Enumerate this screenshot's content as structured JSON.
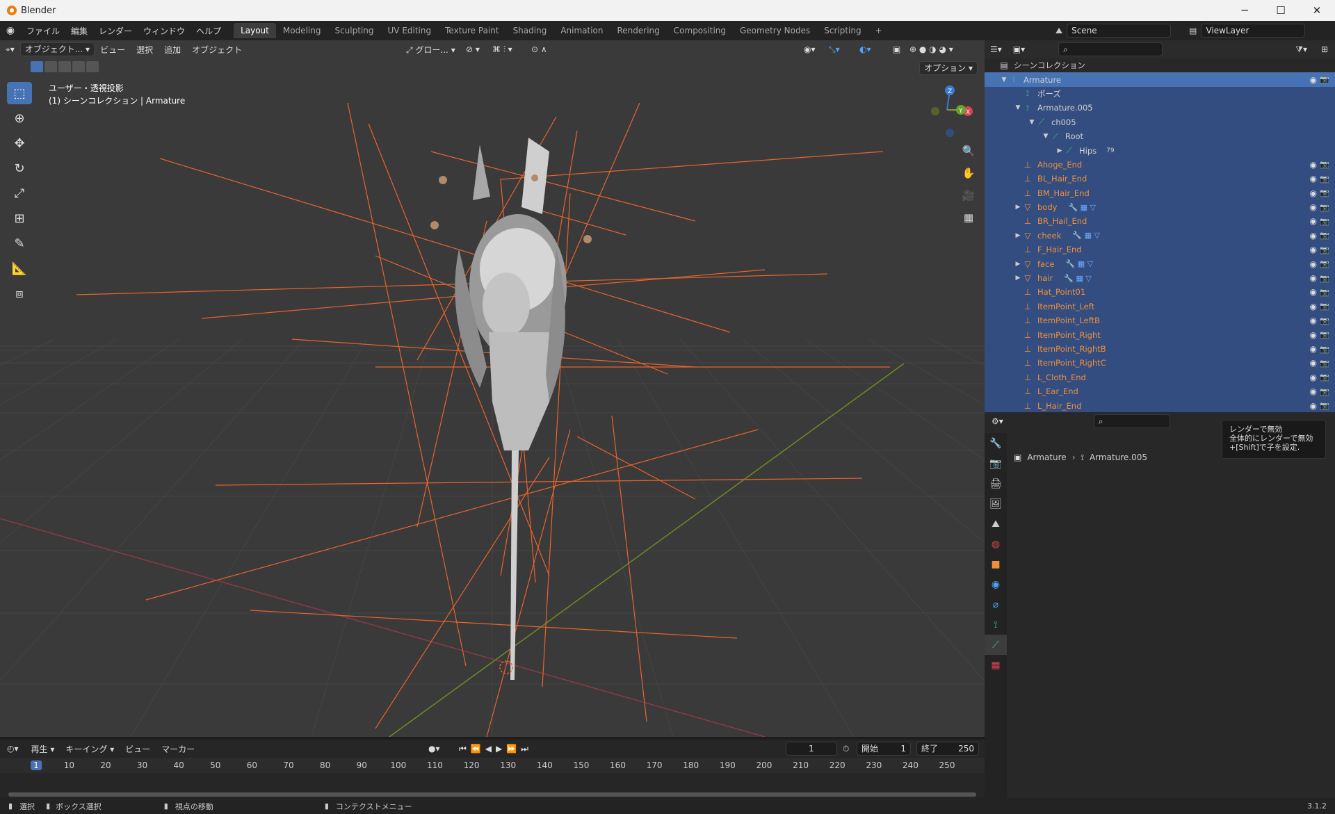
{
  "window": {
    "title": "Blender",
    "min": "─",
    "max": "☐",
    "close": "✕"
  },
  "menu": [
    "ファイル",
    "編集",
    "レンダー",
    "ウィンドウ",
    "ヘルプ"
  ],
  "workspaces": [
    "Layout",
    "Modeling",
    "Sculpting",
    "UV Editing",
    "Texture Paint",
    "Shading",
    "Animation",
    "Rendering",
    "Compositing",
    "Geometry Nodes",
    "Scripting"
  ],
  "scene": {
    "name": "Scene",
    "view_layer": "ViewLayer"
  },
  "viewport": {
    "mode": "オブジェクト...",
    "menus": [
      "ビュー",
      "選択",
      "追加",
      "オブジェクト"
    ],
    "transform": "グロー...",
    "options": "オプション",
    "info_line1": "ユーザー・透視投影",
    "info_line2": "(1) シーンコレクション | Armature"
  },
  "outliner": {
    "root": "シーンコレクション",
    "items": [
      {
        "label": "Armature",
        "depth": 0,
        "arrow": "▼",
        "icon": "armature-icon",
        "style": "selected-strong"
      },
      {
        "label": "ポーズ",
        "depth": 1,
        "arrow": "",
        "icon": "pose-icon",
        "style": "sel"
      },
      {
        "label": "Armature.005",
        "depth": 1,
        "arrow": "▼",
        "icon": "armature-data-icon",
        "style": "sel"
      },
      {
        "label": "ch005",
        "depth": 2,
        "arrow": "▼",
        "icon": "bone-icon",
        "style": "sel"
      },
      {
        "label": "Root",
        "depth": 3,
        "arrow": "▼",
        "icon": "bone-icon",
        "style": "sel"
      },
      {
        "label": "Hips",
        "depth": 4,
        "arrow": "▶",
        "icon": "bone-icon",
        "style": "sel",
        "badge": "79"
      },
      {
        "label": "Ahoge_End",
        "depth": 1,
        "arrow": "",
        "icon": "empty-icon",
        "style": "sel",
        "orange": true
      },
      {
        "label": "BL_Hair_End",
        "depth": 1,
        "arrow": "",
        "icon": "empty-icon",
        "style": "sel",
        "orange": true
      },
      {
        "label": "BM_Hair_End",
        "depth": 1,
        "arrow": "",
        "icon": "empty-icon",
        "style": "sel",
        "orange": true
      },
      {
        "label": "body",
        "depth": 1,
        "arrow": "▶",
        "icon": "mesh-icon",
        "style": "sel",
        "orange": true,
        "mods": true
      },
      {
        "label": "BR_Hail_End",
        "depth": 1,
        "arrow": "",
        "icon": "empty-icon",
        "style": "sel",
        "orange": true
      },
      {
        "label": "cheek",
        "depth": 1,
        "arrow": "▶",
        "icon": "mesh-icon",
        "style": "sel",
        "orange": true,
        "mods": true
      },
      {
        "label": "F_Hair_End",
        "depth": 1,
        "arrow": "",
        "icon": "empty-icon",
        "style": "sel",
        "orange": true
      },
      {
        "label": "face",
        "depth": 1,
        "arrow": "▶",
        "icon": "mesh-icon",
        "style": "sel",
        "orange": true,
        "mods": true
      },
      {
        "label": "hair",
        "depth": 1,
        "arrow": "▶",
        "icon": "mesh-icon",
        "style": "sel",
        "orange": true,
        "mods": true
      },
      {
        "label": "Hat_Point01",
        "depth": 1,
        "arrow": "",
        "icon": "empty-icon",
        "style": "sel",
        "orange": true
      },
      {
        "label": "ItemPoint_Left",
        "depth": 1,
        "arrow": "",
        "icon": "empty-icon",
        "style": "sel",
        "orange": true
      },
      {
        "label": "ItemPoint_LeftB",
        "depth": 1,
        "arrow": "",
        "icon": "empty-icon",
        "style": "sel",
        "orange": true
      },
      {
        "label": "ItemPoint_Right",
        "depth": 1,
        "arrow": "",
        "icon": "empty-icon",
        "style": "sel",
        "orange": true
      },
      {
        "label": "ItemPoint_RightB",
        "depth": 1,
        "arrow": "",
        "icon": "empty-icon",
        "style": "sel",
        "orange": true
      },
      {
        "label": "ItemPoint_RightC",
        "depth": 1,
        "arrow": "",
        "icon": "empty-icon",
        "style": "sel",
        "orange": true
      },
      {
        "label": "L_Cloth_End",
        "depth": 1,
        "arrow": "",
        "icon": "empty-icon",
        "style": "sel",
        "orange": true
      },
      {
        "label": "L_Ear_End",
        "depth": 1,
        "arrow": "",
        "icon": "empty-icon",
        "style": "sel",
        "orange": true
      },
      {
        "label": "L_Hair_End",
        "depth": 1,
        "arrow": "",
        "icon": "empty-icon",
        "style": "sel",
        "orange": true
      }
    ]
  },
  "properties": {
    "breadcrumb_1": "Armature",
    "breadcrumb_2": "Armature.005",
    "tooltip_line1": "レンダーで無効",
    "tooltip_line2": "全体的にレンダーで無効",
    "tooltip_line3": "+[Shift]で子を設定."
  },
  "timeline": {
    "menus": [
      "再生",
      "キーイング",
      "ビュー",
      "マーカー"
    ],
    "current_frame": "1",
    "start_label": "開始",
    "start": "1",
    "end_label": "終了",
    "end": "250",
    "ticks": [
      "1",
      "10",
      "20",
      "30",
      "40",
      "50",
      "60",
      "70",
      "80",
      "90",
      "100",
      "110",
      "120",
      "130",
      "140",
      "150",
      "160",
      "170",
      "180",
      "190",
      "200",
      "210",
      "220",
      "230",
      "240",
      "250"
    ]
  },
  "status": {
    "select": "選択",
    "box_select": "ボックス選択",
    "move_view": "視点の移動",
    "context_menu": "コンテクストメニュー",
    "version": "3.1.2"
  },
  "colors": {
    "accent": "#4772b3",
    "selection": "#334d80",
    "bones": "#e8642c",
    "orange_text": "#f0903a"
  }
}
